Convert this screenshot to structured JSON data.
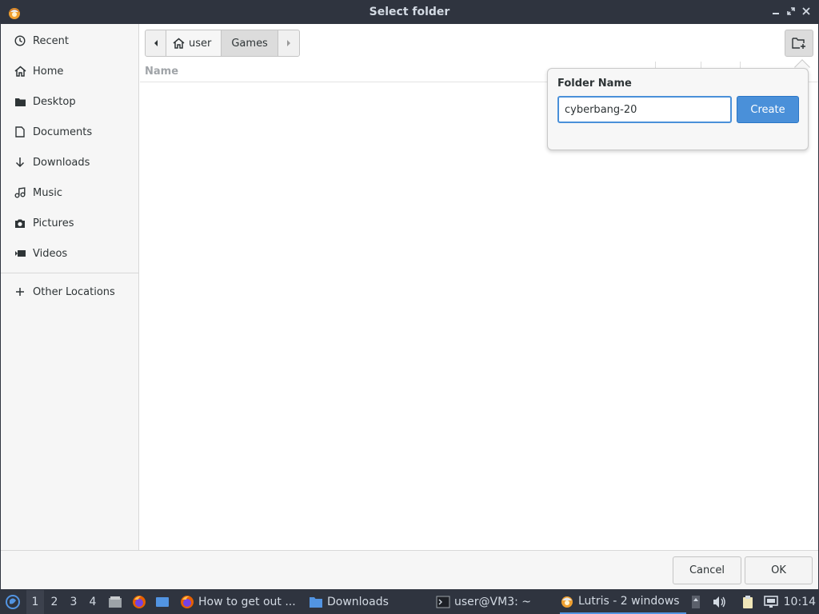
{
  "window": {
    "title": "Select folder"
  },
  "sidebar": {
    "items": [
      {
        "label": "Recent",
        "icon": "clock-icon"
      },
      {
        "label": "Home",
        "icon": "home-icon"
      },
      {
        "label": "Desktop",
        "icon": "folder-icon"
      },
      {
        "label": "Documents",
        "icon": "document-icon"
      },
      {
        "label": "Downloads",
        "icon": "download-icon"
      },
      {
        "label": "Music",
        "icon": "music-icon"
      },
      {
        "label": "Pictures",
        "icon": "camera-icon"
      },
      {
        "label": "Videos",
        "icon": "video-icon"
      }
    ],
    "other_locations": {
      "label": "Other Locations",
      "icon": "plus-icon"
    }
  },
  "pathbar": {
    "segments": [
      "user",
      "Games"
    ]
  },
  "file_list": {
    "column_name": "Name"
  },
  "popover": {
    "title": "Folder Name",
    "input_value": "cyberbang-20",
    "create_label": "Create"
  },
  "actions": {
    "cancel_label": "Cancel",
    "ok_label": "OK"
  },
  "taskbar": {
    "workspaces": [
      "1",
      "2",
      "3",
      "4"
    ],
    "tasks": [
      {
        "label": "How to get out ...",
        "icon": "firefox-icon"
      },
      {
        "label": "Downloads",
        "icon": "folder-icon"
      },
      {
        "label": "user@VM3: ~",
        "icon": "terminal-icon"
      },
      {
        "label": "Lutris - 2 windows",
        "icon": "lutris-icon"
      }
    ],
    "clock": "10:14"
  },
  "colors": {
    "accent": "#4a90d9",
    "titlebar": "#2f343f"
  }
}
